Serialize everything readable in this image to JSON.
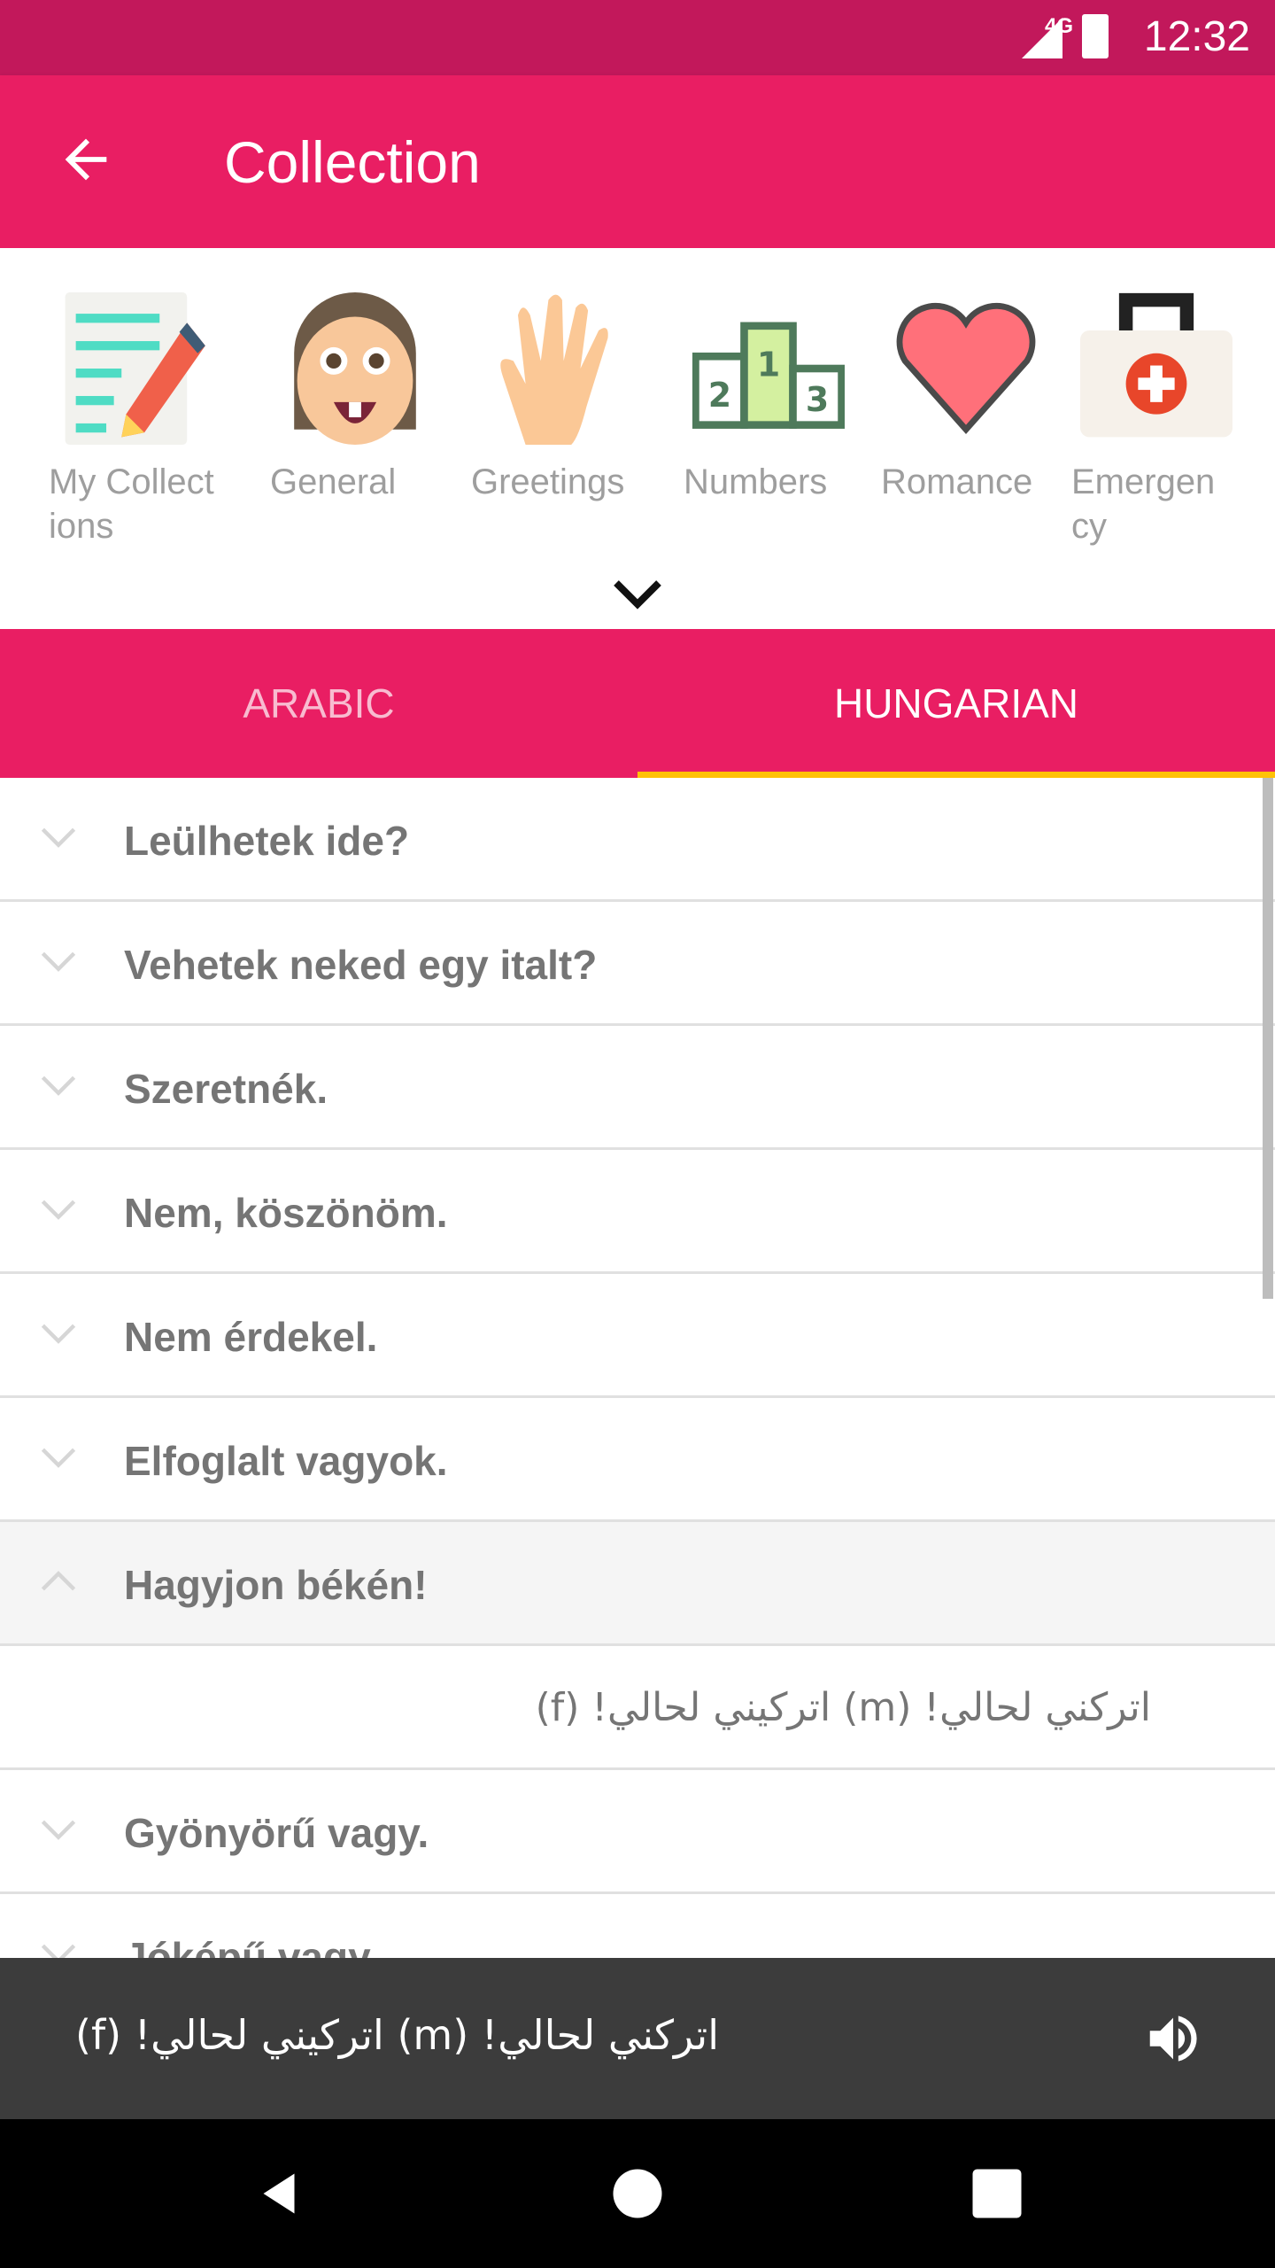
{
  "status_bar": {
    "network": "4G",
    "time": "12:32"
  },
  "app_bar": {
    "title": "Collection"
  },
  "categories": [
    {
      "label": "My Collect ions",
      "icon": "notepad-pencil-icon"
    },
    {
      "label": "General",
      "icon": "face-icon"
    },
    {
      "label": "Greetings",
      "icon": "hand-wave-icon"
    },
    {
      "label": "Numbers",
      "icon": "podium-icon"
    },
    {
      "label": "Romance",
      "icon": "heart-icon"
    },
    {
      "label": "Emergen cy",
      "icon": "first-aid-kit-icon"
    }
  ],
  "tabs": [
    {
      "label": "ARABIC",
      "selected": false
    },
    {
      "label": "HUNGARIAN",
      "selected": true
    }
  ],
  "phrases": [
    "Leülhetek ide?",
    "Vehetek neked egy italt?",
    "Szeretnék.",
    "Nem, köszönöm.",
    "Nem érdekel.",
    "Elfoglalt vagyok.",
    "Hagyjon békén!",
    "Gyönyörű vagy.",
    "Jóképű vagy."
  ],
  "expanded": {
    "phrase": "Hagyjon békén!",
    "translation": "اتركني لحالي! (m)  اتركيني لحالي! (f)"
  },
  "player": {
    "text": "اتركني لحالي! (m)  اتركيني لحالي! (f)",
    "icon": "speaker-icon"
  },
  "colors": {
    "status": "#C2185B",
    "primary": "#E91E63",
    "indicator": "#FFC107"
  }
}
